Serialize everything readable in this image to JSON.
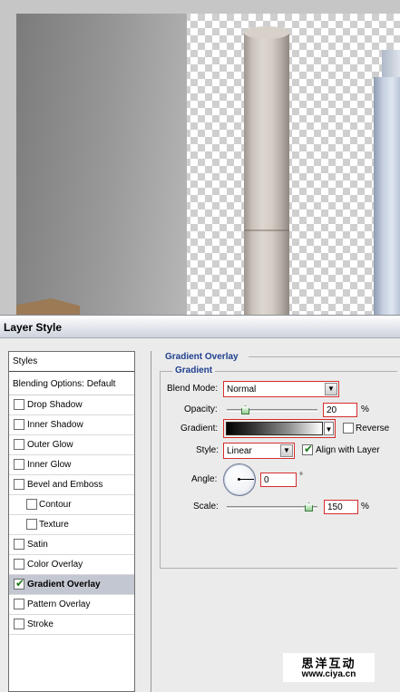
{
  "dialog": {
    "title": "Layer Style"
  },
  "styles_panel": {
    "header": "Styles",
    "blending_options": "Blending Options: Default",
    "items": [
      {
        "label": "Drop Shadow",
        "checked": false,
        "sub": false,
        "selected": false
      },
      {
        "label": "Inner Shadow",
        "checked": false,
        "sub": false,
        "selected": false
      },
      {
        "label": "Outer Glow",
        "checked": false,
        "sub": false,
        "selected": false
      },
      {
        "label": "Inner Glow",
        "checked": false,
        "sub": false,
        "selected": false
      },
      {
        "label": "Bevel and Emboss",
        "checked": false,
        "sub": false,
        "selected": false
      },
      {
        "label": "Contour",
        "checked": false,
        "sub": true,
        "selected": false
      },
      {
        "label": "Texture",
        "checked": false,
        "sub": true,
        "selected": false
      },
      {
        "label": "Satin",
        "checked": false,
        "sub": false,
        "selected": false
      },
      {
        "label": "Color Overlay",
        "checked": false,
        "sub": false,
        "selected": false
      },
      {
        "label": "Gradient Overlay",
        "checked": true,
        "sub": false,
        "selected": true
      },
      {
        "label": "Pattern Overlay",
        "checked": false,
        "sub": false,
        "selected": false
      },
      {
        "label": "Stroke",
        "checked": false,
        "sub": false,
        "selected": false
      }
    ]
  },
  "gradient_overlay": {
    "section_title": "Gradient Overlay",
    "group_title": "Gradient",
    "blend_mode_label": "Blend Mode:",
    "blend_mode_value": "Normal",
    "opacity_label": "Opacity:",
    "opacity_value": "20",
    "opacity_fraction": 0.2,
    "percent_unit": "%",
    "gradient_label": "Gradient:",
    "reverse_label": "Reverse",
    "reverse_checked": false,
    "style_label": "Style:",
    "style_value": "Linear",
    "align_label": "Align with Layer",
    "align_checked": true,
    "angle_label": "Angle:",
    "angle_value": "0",
    "degree_unit": "°",
    "scale_label": "Scale:",
    "scale_value": "150",
    "scale_fraction": 0.9
  },
  "watermark": {
    "cn": "思洋互动",
    "url": "www.ciya.cn"
  },
  "colors": {
    "highlight": "#d62d2d",
    "section_title": "#1f3f8f",
    "selection": "#c3c7d1"
  }
}
